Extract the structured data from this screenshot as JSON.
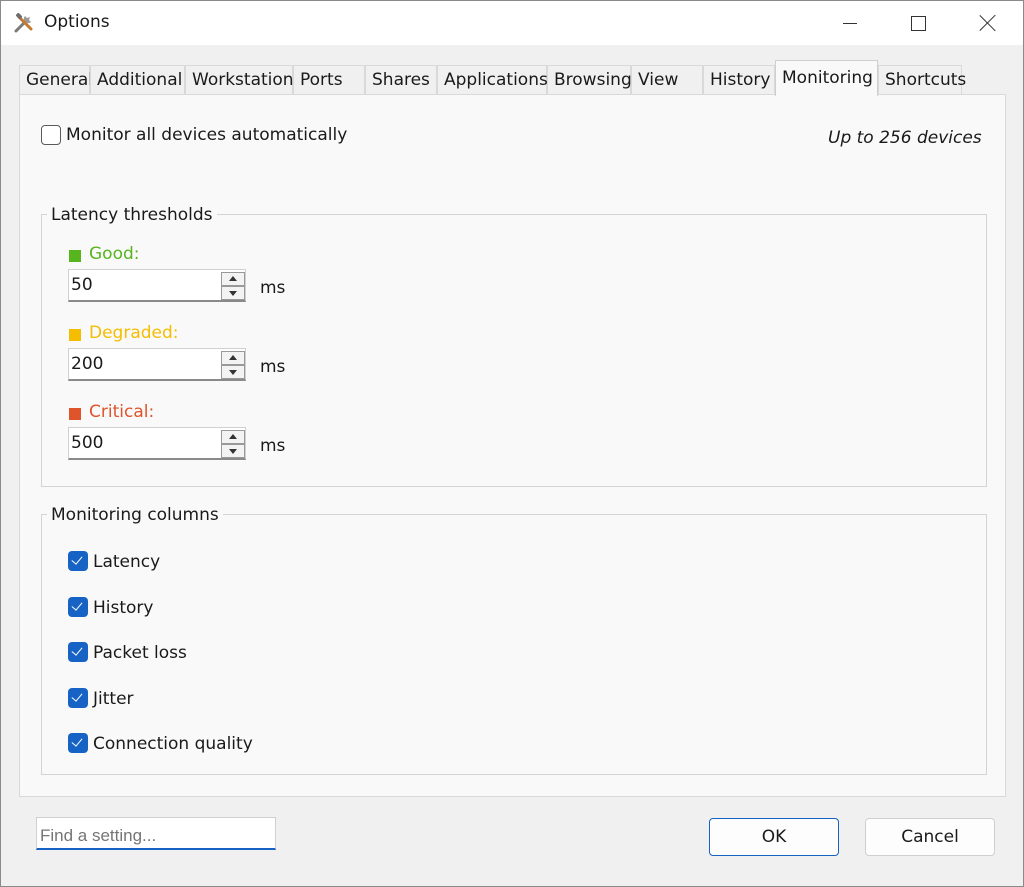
{
  "window": {
    "title": "Options"
  },
  "tabs": [
    {
      "label": "General"
    },
    {
      "label": "Additional"
    },
    {
      "label": "Workstation"
    },
    {
      "label": "Ports"
    },
    {
      "label": "Shares"
    },
    {
      "label": "Applications"
    },
    {
      "label": "Browsing"
    },
    {
      "label": "View"
    },
    {
      "label": "History"
    },
    {
      "label": "Monitoring",
      "active": true
    },
    {
      "label": "Shortcuts"
    }
  ],
  "monitoring": {
    "auto_monitor": {
      "label": "Monitor all devices automatically",
      "checked": false
    },
    "device_limit_note": "Up to 256 devices",
    "latency_group": {
      "title": "Latency thresholds",
      "thresholds": [
        {
          "name": "Good:",
          "value": "50",
          "unit": "ms",
          "color": "#57b51e"
        },
        {
          "name": "Degraded:",
          "value": "200",
          "unit": "ms",
          "color": "#f5bd00"
        },
        {
          "name": "Critical:",
          "value": "500",
          "unit": "ms",
          "color": "#e0542b"
        }
      ]
    },
    "columns_group": {
      "title": "Monitoring columns",
      "columns": [
        {
          "label": "Latency",
          "checked": true
        },
        {
          "label": "History",
          "checked": true
        },
        {
          "label": "Packet loss",
          "checked": true
        },
        {
          "label": "Jitter",
          "checked": true
        },
        {
          "label": "Connection quality",
          "checked": true
        }
      ]
    }
  },
  "footer": {
    "search": {
      "placeholder": "Find a setting..."
    },
    "ok_label": "OK",
    "cancel_label": "Cancel"
  },
  "colors": {
    "accent": "#1663c5"
  }
}
